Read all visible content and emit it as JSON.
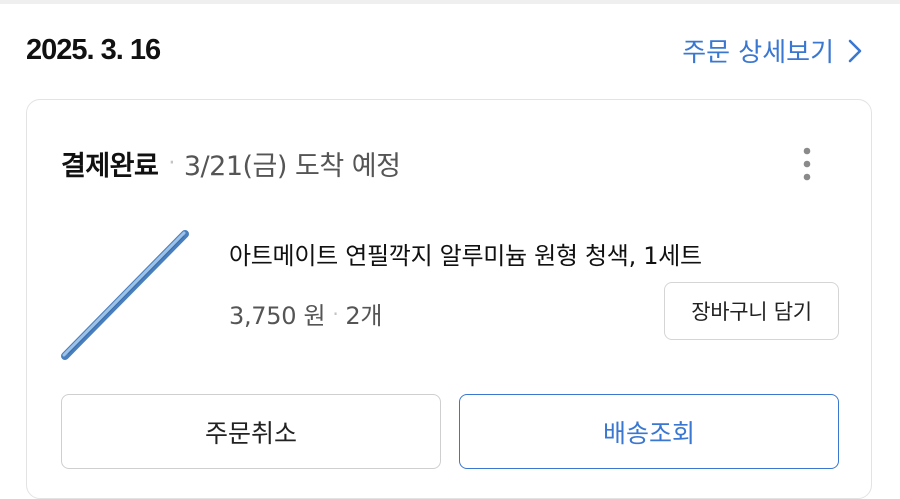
{
  "order": {
    "date": "2025. 3. 16",
    "detail_link_label": "주문 상세보기"
  },
  "card": {
    "status": "결제완료",
    "separator": "·",
    "eta": "3/21(금) 도착 예정",
    "product": {
      "name": "아트메이트 연필깍지 알루미늄 원형 청색, 1세트",
      "price": "3,750 원",
      "quantity": "2개",
      "image_icon": "blue-pencil-extender-image"
    },
    "add_to_cart_label": "장바구니 담기",
    "cancel_label": "주문취소",
    "track_label": "배송조회"
  },
  "colors": {
    "accent": "#3a77d1",
    "text": "#111111",
    "muted": "#555555",
    "border": "#e3e3e3"
  }
}
